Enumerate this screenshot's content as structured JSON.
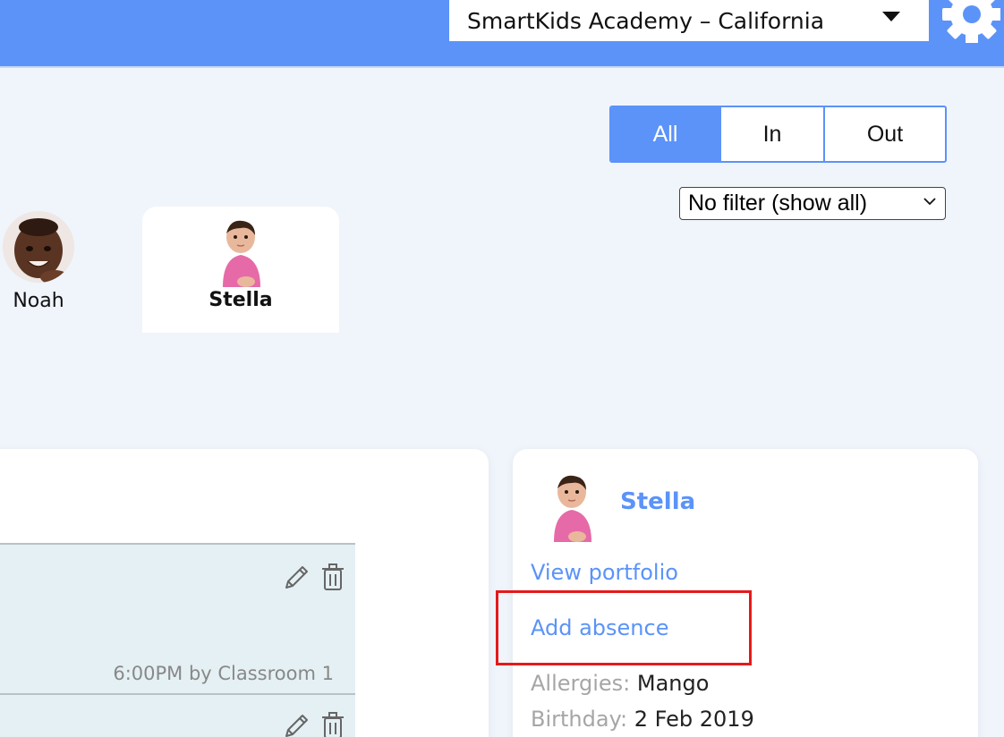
{
  "header": {
    "school": "SmartKids Academy – California"
  },
  "filters": {
    "segments": [
      "All",
      "In",
      "Out"
    ],
    "active_segment": "All",
    "dropdown_value": "No filter (show all)"
  },
  "children": [
    {
      "name": "Noah"
    },
    {
      "name": "Stella"
    }
  ],
  "activity": {
    "entry_meta": "6:00PM by Classroom 1"
  },
  "profile": {
    "name": "Stella",
    "view_portfolio": "View portfolio",
    "add_absence": "Add absence",
    "allergies_label": "Allergies:",
    "allergies_value": "Mango",
    "birthday_label": "Birthday:",
    "birthday_value": "2 Feb 2019"
  },
  "colors": {
    "brand_blue": "#5b93f8",
    "highlight_red": "#e51a1a",
    "entry_bg": "#e5f0f4"
  },
  "icons": [
    "gear-icon",
    "chevron-down-icon",
    "pencil-icon",
    "trash-icon"
  ]
}
